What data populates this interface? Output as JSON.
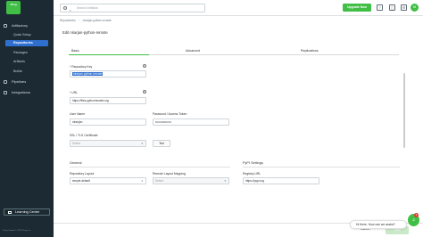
{
  "sidebar": {
    "logo_text": "Jfrog",
    "sections": [
      {
        "label": "Artifactory"
      },
      {
        "label": "Pipelines"
      },
      {
        "label": "Integrations"
      }
    ],
    "sub_items": [
      {
        "label": "Quick Setup"
      },
      {
        "label": "Repositories"
      },
      {
        "label": "Packages"
      },
      {
        "label": "Artifacts"
      },
      {
        "label": "Builds"
      }
    ],
    "learning_center": "Learning Center",
    "copyright": "JFrog Limited © 2023 JFrog, Inc."
  },
  "topbar": {
    "search_placeholder": "Search Artifacts",
    "upgrade_label": "Upgrade Now",
    "avatar_text": "N"
  },
  "breadcrumb": {
    "items": [
      "Repositories",
      "nirarjan-python-remote"
    ]
  },
  "page": {
    "title": "Edit nirarjan-python-remote"
  },
  "tabs": [
    {
      "label": "Basic"
    },
    {
      "label": "Advanced"
    },
    {
      "label": "Replications"
    }
  ],
  "form": {
    "repo_key_label": "* Repository Key",
    "repo_key_value": "nirarjan-python-remote",
    "url_label": "* URL",
    "url_value": "https://files.pythonhosted.org",
    "username_label": "User Name",
    "username_value": "niranjan",
    "password_label": "Password / Access Token",
    "password_value": "••••••••••••••••",
    "ssl_label": "SSL / TLS Certificate",
    "ssl_placeholder": "Select",
    "test_label": "Test"
  },
  "general": {
    "heading": "General",
    "layout_label": "Repository Layout",
    "layout_value": "simple-default",
    "remote_layout_label": "Remote Layout Mapping",
    "remote_layout_placeholder": "Select"
  },
  "pypi": {
    "heading": "PyPI Settings",
    "registry_label": "Registry URL",
    "registry_value": "https://pypi.org"
  },
  "footer": {
    "cancel_label": "Cancel",
    "save_label": "Save"
  },
  "chat": {
    "message": "Hi there. How can we assist?",
    "bot_text": "J",
    "badge": "1"
  }
}
